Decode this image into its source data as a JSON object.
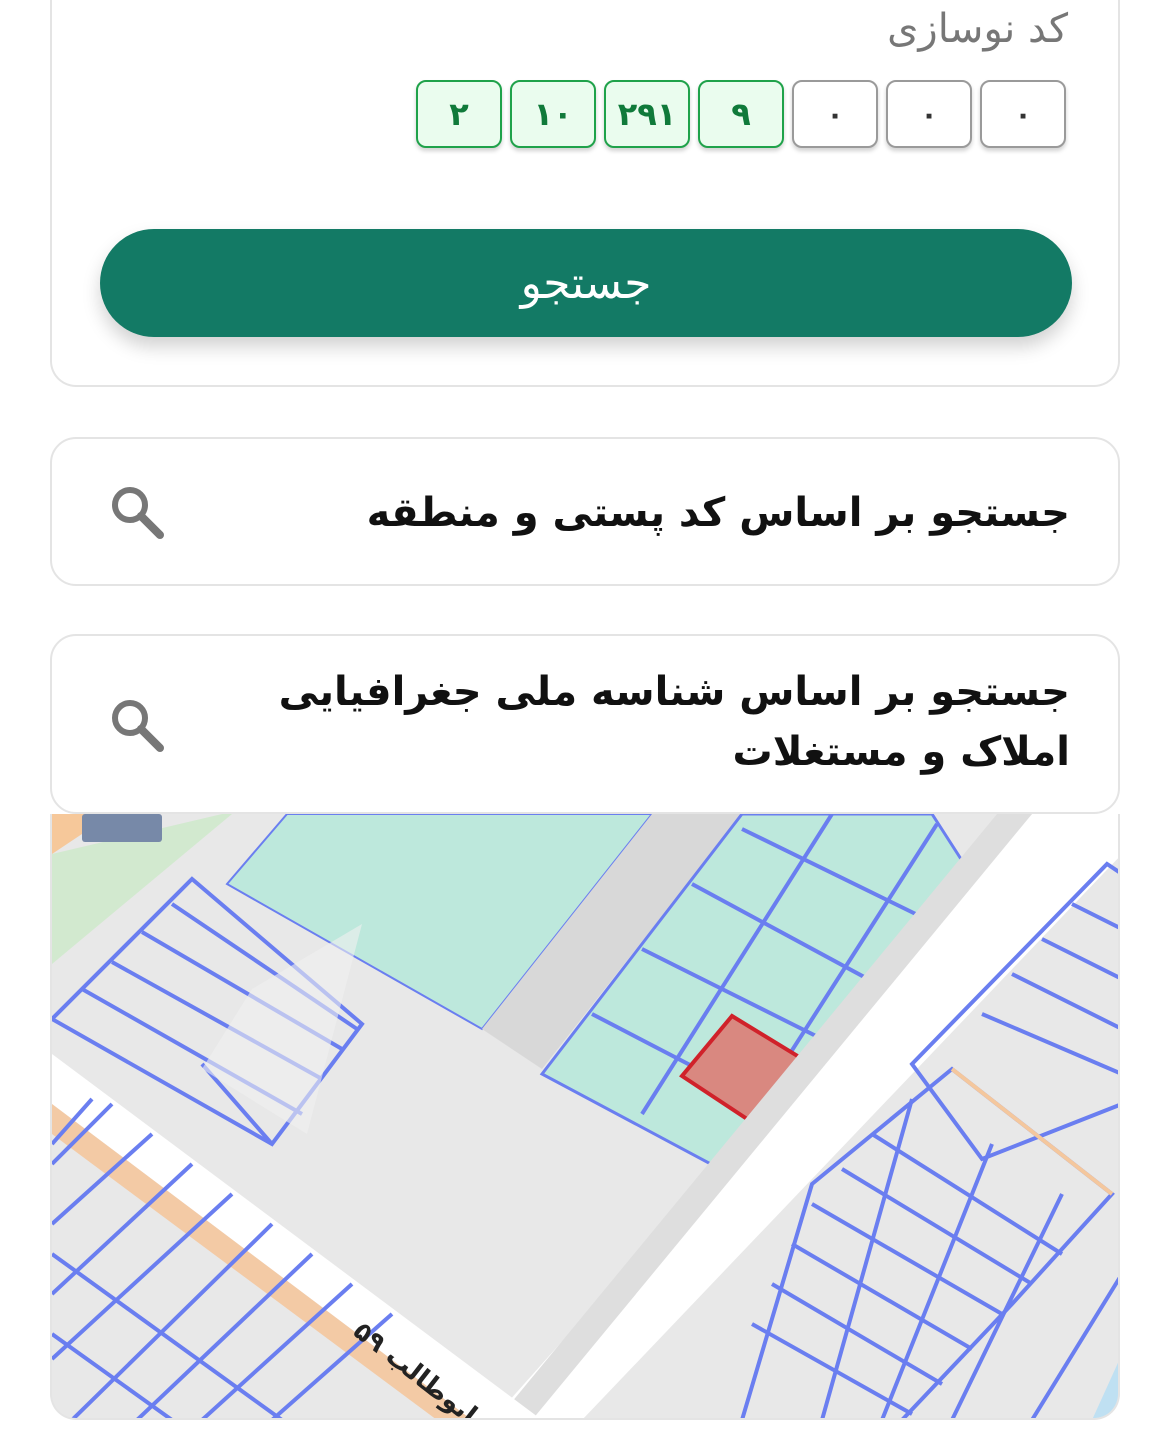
{
  "renovation_code": {
    "label": "کد نوسازی",
    "boxes": [
      "٠",
      "٠",
      "٠",
      "٩",
      "٢٩١",
      "١٠",
      "٢"
    ],
    "search_label": "جستجو"
  },
  "options": [
    {
      "label": "جستجو بر اساس کد پستی و منطقه"
    },
    {
      "label": "جستجو بر اساس شناسه ملی جغرافیایی املاک و مستغلات"
    }
  ],
  "map": {
    "street_label": "ابوطالب ۵۹",
    "colors": {
      "parcel_line": "#6a7ef0",
      "parcel_fill": "#bde8dc",
      "road": "#ffffff",
      "selected_fill": "#d98880",
      "selected_stroke": "#d0222a",
      "accent_green": "#137a65"
    }
  }
}
